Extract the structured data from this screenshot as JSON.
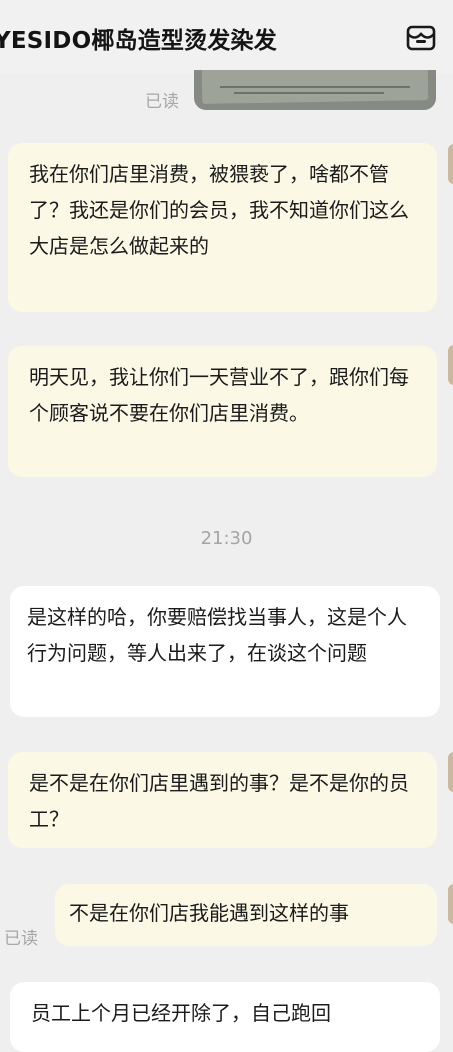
{
  "header": {
    "title": "YESIDO椰岛造型烫发染发",
    "store_icon": "store-icon"
  },
  "messages": [
    {
      "type": "image",
      "status": "已读"
    },
    {
      "type": "text",
      "text": "我在你们店里消费，被猥亵了，啥都不管了？我还是你们的会员，我不知道你们这么大店是怎么做起来的"
    },
    {
      "type": "text",
      "text": "明天见，我让你们一天营业不了，跟你们每个顾客说不要在你们店里消费。"
    },
    {
      "type": "timestamp",
      "text": "21:30"
    },
    {
      "type": "text",
      "text": "是这样的哈，你要赔偿找当事人，这是个人行为问题，等人出来了，在谈这个问题"
    },
    {
      "type": "text",
      "text": "是不是在你们店里遇到的事？是不是你的员工？"
    },
    {
      "type": "text",
      "text": "不是在你们店我能遇到这样的事",
      "status": "已读"
    },
    {
      "type": "text",
      "text": "员工上个月已经开除了，自己跑回"
    }
  ]
}
